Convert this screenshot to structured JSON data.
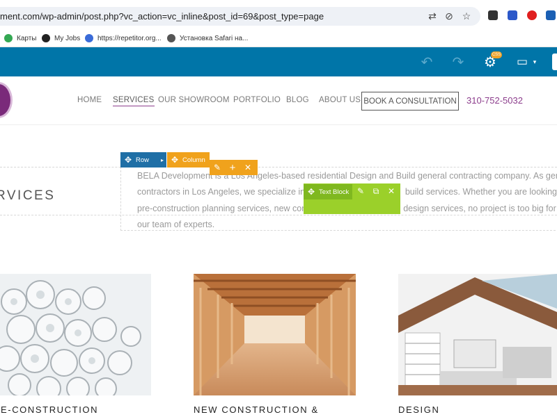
{
  "browser": {
    "url": "ment.com/wp-admin/post.php?vc_action=vc_inline&post_id=69&post_type=page",
    "icons": [
      "translate-icon",
      "eye-off-icon",
      "star-icon"
    ],
    "bookmarks": [
      {
        "label": "Карты",
        "color": "#34a853"
      },
      {
        "label": "My Jobs",
        "color": "#222222"
      },
      {
        "label": "https://repetitor.org...",
        "color": "#3a6bd8"
      },
      {
        "label": "Установка Safari на...",
        "color": "#555555"
      }
    ]
  },
  "vc_toolbar": {
    "css_badge": "CSS",
    "colors": {
      "bar": "#0075a8"
    }
  },
  "header": {
    "nav": [
      "HOME",
      "SERVICES",
      "OUR SHOWROOM",
      "PORTFOLIO",
      "BLOG",
      "ABOUT US"
    ],
    "active": "SERVICES",
    "cta": "BOOK A CONSULTATION",
    "phone": "310-752-5032"
  },
  "editor": {
    "row_label": "Row",
    "column_label": "Column",
    "text_block_label": "Text Block",
    "colors": {
      "row": "#1f6fa6",
      "column": "#f0a21c",
      "text_block": "#9bd02a"
    }
  },
  "content": {
    "section_title": "RVICES",
    "paragraph_lines": [
      "BELA Development is a Los Angeles-based residential Design and Build general contracting company. As genera",
      "contractors in Los Angeles, we specialize in c",
      "pre-construction planning services, new con",
      "our team of experts."
    ],
    "paragraph_tail": {
      "line2": "build services. Whether you are looking fo",
      "line3": "design services, no project is too big for"
    }
  },
  "cards": [
    {
      "title": "RE-CONSTRUCTION"
    },
    {
      "title": "NEW CONSTRUCTION &"
    },
    {
      "title": "DESIGN"
    }
  ]
}
